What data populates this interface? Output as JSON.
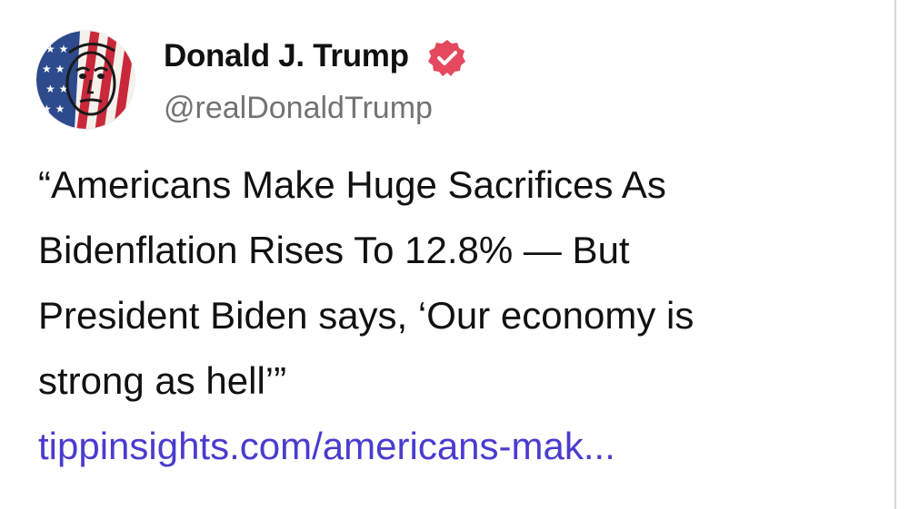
{
  "post": {
    "author": {
      "name": "Donald J. Trump",
      "handle": "@realDonaldTrump",
      "verified_badge_color": "#e5485f",
      "avatar": "flag-painted-portrait"
    },
    "text": "“Americans Make Huge Sacrifices As\nBidenflation Rises To 12.8% — But\nPresident Biden says, ‘Our economy is\nstrong as hell’”",
    "link_text": "tippinsights.com/americans-mak...",
    "link_color": "#4a3ccf"
  }
}
